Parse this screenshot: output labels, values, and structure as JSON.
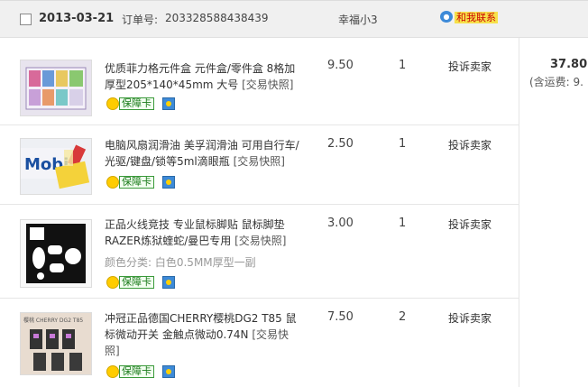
{
  "order": {
    "date": "2013-03-21",
    "order_label": "订单号:",
    "order_number": "203328588438439",
    "seller": "幸福小3",
    "contact_label": "和我联系",
    "total": "37.80",
    "shipping_note": "(含运费: 9."
  },
  "items": [
    {
      "title": "优质菲力格元件盒 元件盒/零件盒 8格加厚型205*140*45mm 大号",
      "snapshot": "[交易快照]",
      "price": "9.50",
      "qty": "1",
      "badge": "保障卡",
      "complain": "投诉卖家",
      "thumb_text": "",
      "sku": ""
    },
    {
      "title": "电脑风扇润滑油 美孚润滑油 可用自行车/光驱/键盘/锁等5ml滴眼瓶",
      "snapshot": "[交易快照]",
      "price": "2.50",
      "qty": "1",
      "badge": "保障卡",
      "complain": "投诉卖家",
      "thumb_text": "Mobil",
      "sku": ""
    },
    {
      "title": "正品火线竞技 专业鼠标脚贴 鼠标脚垫RAZER炼狱蝰蛇/曼巴专用",
      "snapshot": "[交易快照]",
      "price": "3.00",
      "qty": "1",
      "badge": "保障卡",
      "complain": "投诉卖家",
      "thumb_text": "",
      "sku": "颜色分类: 白色0.5MM厚型一副"
    },
    {
      "title": "冲冠正品德国CHERRY樱桃DG2 T85 鼠标微动开关 金触点微动0.74N",
      "snapshot": "[交易快照]",
      "price": "7.50",
      "qty": "2",
      "badge": "保障卡",
      "complain": "投诉卖家",
      "thumb_text": "樱桃 CHERRY DG2 T85",
      "sku": ""
    }
  ],
  "colors": {
    "header_bg": "#f0f0f0",
    "contact_bg": "#f6e14a",
    "contact_text": "#cc0000",
    "badge_green": "#1a7a1a"
  }
}
